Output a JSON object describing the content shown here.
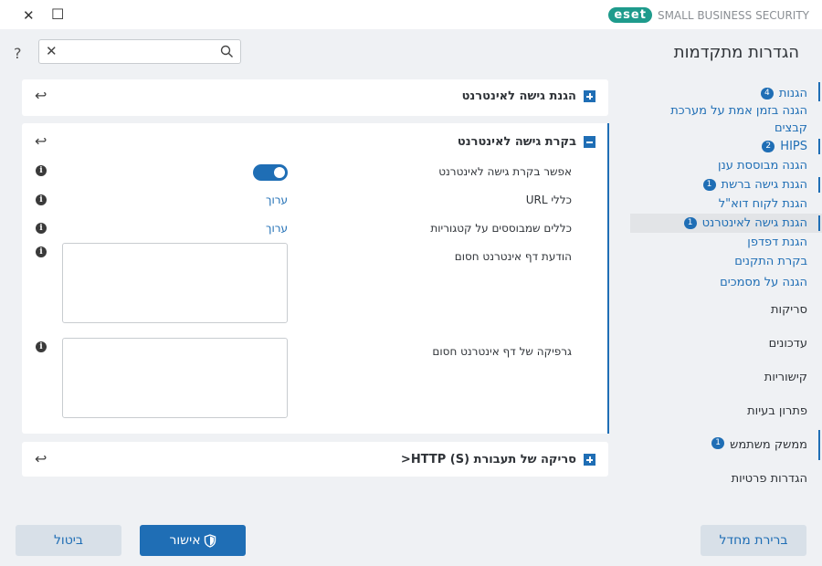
{
  "window": {
    "close_symbol": "✕",
    "maximize_symbol": "☐",
    "brand_logo": "eset",
    "brand_text": "SMALL BUSINESS SECURITY"
  },
  "help_symbol": "?",
  "search": {
    "placeholder": "",
    "value": "",
    "clear_symbol": "✕"
  },
  "title": "הגדרות מתקדמות",
  "nav": {
    "items": [
      {
        "label": "הגנות",
        "badge": "4"
      },
      {
        "label": "הגנה בזמן אמת על מערכת"
      },
      {
        "label": "קבצים"
      },
      {
        "label": "HIPS",
        "badge": "2"
      },
      {
        "label": "הגנה מבוססת ענן"
      },
      {
        "label": "הגנת גישה ברשת",
        "badge": "1"
      },
      {
        "label": "הגנת לקוח דוא\"ל"
      },
      {
        "label": "הגנת גישה לאינטרנט",
        "badge": "1"
      },
      {
        "label": "הגנת דפדפן"
      },
      {
        "label": "בקרת התקנים"
      },
      {
        "label": "הגנה על מסמכים"
      },
      {
        "label": "סריקות"
      },
      {
        "label": "עדכונים"
      },
      {
        "label": "קישוריות"
      },
      {
        "label": "פתרון בעיות"
      },
      {
        "label": "ממשק משתמש",
        "badge": "1"
      },
      {
        "label": "הגדרות פרטיות"
      }
    ]
  },
  "panels": {
    "web_protection": {
      "title": "הגנת גישה לאינטרנט"
    },
    "web_control": {
      "title": "בקרת גישה לאינטרנט",
      "rows": {
        "enable_label": "אפשר בקרת גישה לאינטרנט",
        "enable_value": "on",
        "url_rules_label": "כללי URL",
        "url_rules_link": "ערוך",
        "category_rules_label": "כללים שמבוססים על קטגוריות",
        "category_rules_link": "ערוך",
        "blocked_message_label": "הודעת דף אינטרנט חסום",
        "blocked_graphic_label": "גרפיקה של דף אינטרנט חסום"
      }
    },
    "http_scan": {
      "title": "סריקה של תעבורת (S) HTTP<"
    }
  },
  "icons": {
    "undo": "↩",
    "info": "i"
  },
  "buttons": {
    "default": "ברירת מחדל",
    "ok": "אישור",
    "cancel": "ביטול"
  },
  "colors": {
    "accent": "#1f6eb5",
    "brand": "#1e9b8c",
    "background": "#eff1f4"
  }
}
